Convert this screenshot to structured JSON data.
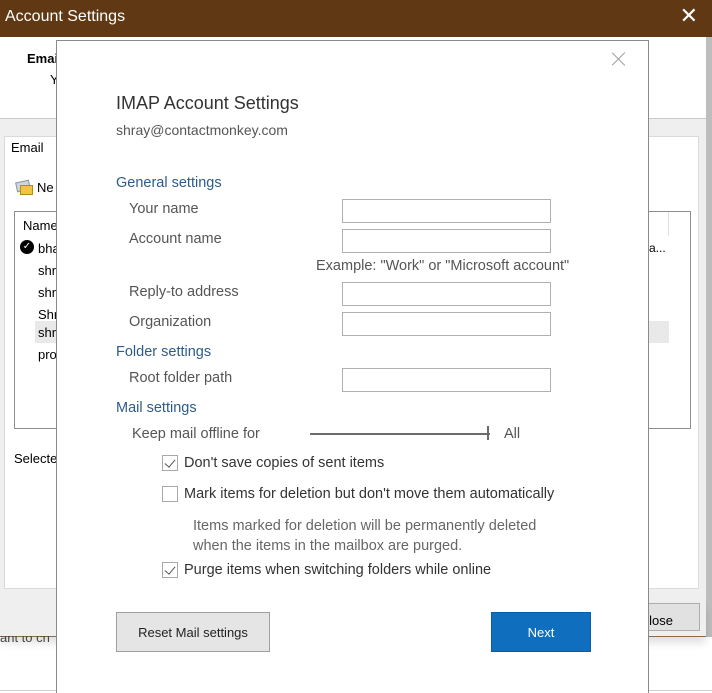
{
  "background_window": {
    "title": "Account Settings",
    "close_icon": "close-icon",
    "header_title": "Emai",
    "header_sub": "Y",
    "tab_label": "Email",
    "new_button_label": "Ne",
    "new_button_icon": "envelope-icon",
    "list": {
      "column_header": "Name",
      "rows": [
        "bha",
        "shr",
        "shr",
        "Shr",
        "shr",
        "pro"
      ],
      "default_check_icon": "checkmark-circle-icon",
      "truncated_value": "a..."
    },
    "selected_label": "Selecte",
    "close_button_label": "lose",
    "footer_text": "ant to ch"
  },
  "dialog": {
    "close_icon": "close-icon",
    "title": "IMAP Account Settings",
    "email": "shray@contactmonkey.com",
    "general_settings": {
      "heading": "General settings",
      "your_name_label": "Your name",
      "your_name_value": "",
      "account_name_label": "Account name",
      "account_name_value": "",
      "account_name_hint": "Example: \"Work\" or \"Microsoft account\"",
      "reply_to_label": "Reply-to address",
      "reply_to_value": "",
      "organization_label": "Organization",
      "organization_value": ""
    },
    "folder_settings": {
      "heading": "Folder settings",
      "root_folder_label": "Root folder path",
      "root_folder_value": ""
    },
    "mail_settings": {
      "heading": "Mail settings",
      "keep_offline_label": "Keep mail offline for",
      "keep_offline_value": "All",
      "keep_offline_position": 1.0,
      "options": [
        {
          "label": "Don't save copies of sent items",
          "checked": true
        },
        {
          "label": "Mark items for deletion but don't move them automatically",
          "checked": false
        },
        {
          "label": "Purge items when switching folders while online",
          "checked": true
        }
      ],
      "deletion_note_line1": "Items marked for deletion will be permanently deleted",
      "deletion_note_line2": "when the items in the mailbox are purged."
    },
    "buttons": {
      "reset_label": "Reset Mail settings",
      "next_label": "Next"
    },
    "colors": {
      "section_heading": "#2e5c8a",
      "primary_button": "#106ebe",
      "titlebar": "#603814"
    }
  }
}
